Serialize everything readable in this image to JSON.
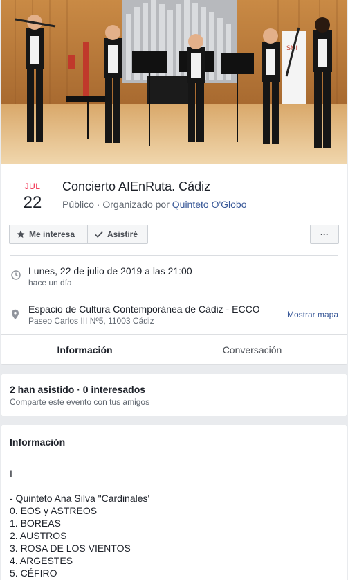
{
  "event": {
    "month": "JUL",
    "day": "22",
    "title": "Concierto AIEnRuta. Cádiz",
    "visibility": "Público · Organizado por ",
    "organizer": "Quinteto O'Globo"
  },
  "actions": {
    "interest_label": "Me interesa",
    "going_label": "Asistiré",
    "more_label": "···"
  },
  "when": {
    "datetime": "Lunes, 22 de julio de 2019 a las 21:00",
    "relative": "hace un día",
    "icon": "clock-icon"
  },
  "where": {
    "venue": "Espacio de Cultura Contemporánea de Cádiz - ECCO",
    "address": "Paseo Carlos III Nº5, 11003 Cádiz",
    "map_link": "Mostrar mapa",
    "icon": "location-pin-icon"
  },
  "tabs": [
    {
      "label": "Información",
      "active": true
    },
    {
      "label": "Conversación",
      "active": false
    }
  ],
  "stats": {
    "summary": "2 han asistido · 0 interesados",
    "share": "Comparte este evento con tus amigos"
  },
  "details": {
    "title": "Información",
    "lines": [
      "I",
      "",
      "- Quinteto Ana Silva \"Cardinales'",
      "0. EOS y ASTREOS",
      "1. BOREAS",
      "2. AUSTROS",
      "3. ROSA DE LOS VIENTOS",
      "4. ARGESTES",
      "5. CÉFIRO"
    ]
  },
  "colors": {
    "accent": "#4267b2",
    "link": "#385898",
    "month": "#f02849"
  }
}
